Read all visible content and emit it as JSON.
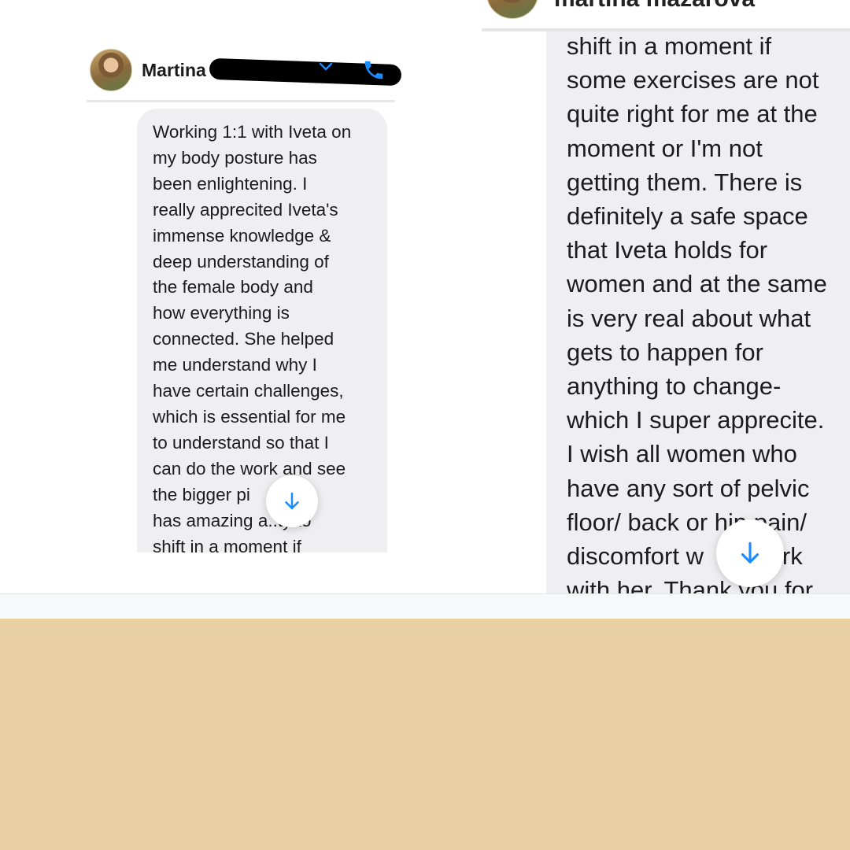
{
  "left_panel": {
    "contact_name": "Martina",
    "message_lines": [
      "Working 1:1 with Iveta on",
      "my body posture has",
      "been enlightening. I",
      "really apprecited Iveta's",
      "immense knowledge &",
      "deep understanding of",
      "the female body and",
      "how everything is",
      "connected. She helped",
      "me understand why I",
      "have certain challenges,",
      "which is essential for me",
      "to understand so that I",
      "can do the work and see",
      "the bigger pi     Iveta",
      "has amazing a..ty to",
      "shift in a moment if"
    ],
    "icons": [
      "chevron-down-icon",
      "phone-icon",
      "arrow-down-icon"
    ]
  },
  "right_panel": {
    "contact_name_partial": "martina mazarova",
    "message_lines": [
      "shift in a moment if",
      "some exercises are not",
      "quite right for me at the",
      "moment or I'm not",
      "getting them. There is",
      "definitely a safe space",
      "that Iveta holds for",
      "women and at the same",
      "is very real about what",
      "gets to happen for",
      "anything to change-",
      "which I super apprecite.",
      "I wish all women who",
      "have any sort of pelvic",
      "floor/ back or hip pain/",
      "discomfort w       work",
      "with her. Thank you for"
    ],
    "icons": [
      "arrow-down-icon"
    ]
  },
  "colors": {
    "accent_blue": "#1a8cff",
    "bubble_gray": "#efeff1",
    "background_beige": "#e9d1a3"
  }
}
